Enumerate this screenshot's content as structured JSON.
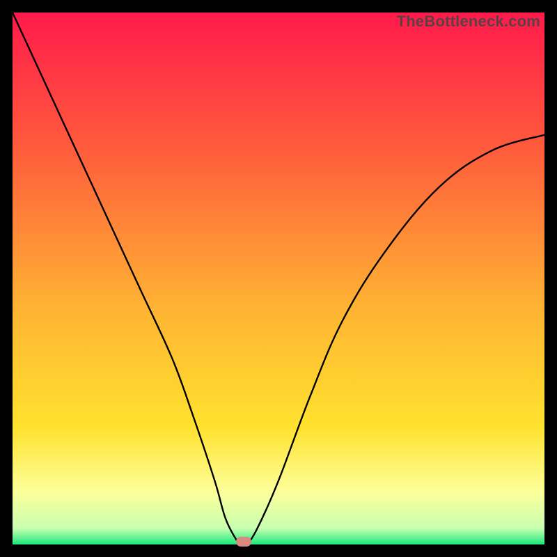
{
  "watermark": "TheBottleneck.com",
  "colors": {
    "top": "#ff1a4a",
    "upper": "#ff5a3c",
    "mid": "#ffb233",
    "lowmid": "#ffe22e",
    "paleyellow": "#feff9a",
    "nearbottom": "#c7ffb0",
    "bottom": "#17e97a",
    "curve": "#000000",
    "marker": "#d98a80"
  },
  "chart_data": {
    "type": "line",
    "title": "",
    "xlabel": "",
    "ylabel": "",
    "xlim": [
      0,
      100
    ],
    "ylim": [
      0,
      100
    ],
    "annotations": [
      {
        "text": "TheBottleneck.com",
        "pos": "top-right"
      }
    ],
    "series": [
      {
        "name": "bottleneck-curve",
        "x": [
          0,
          6,
          12,
          18,
          24,
          30,
          34,
          38,
          40,
          42,
          43,
          44,
          46,
          50,
          56,
          62,
          70,
          80,
          90,
          100
        ],
        "y": [
          100,
          87,
          74,
          61,
          48,
          35,
          24,
          12,
          5,
          1,
          0,
          0,
          3,
          12,
          28,
          42,
          55,
          67,
          74,
          77
        ]
      }
    ],
    "marker": {
      "x": 43.5,
      "y": 0.5
    }
  }
}
